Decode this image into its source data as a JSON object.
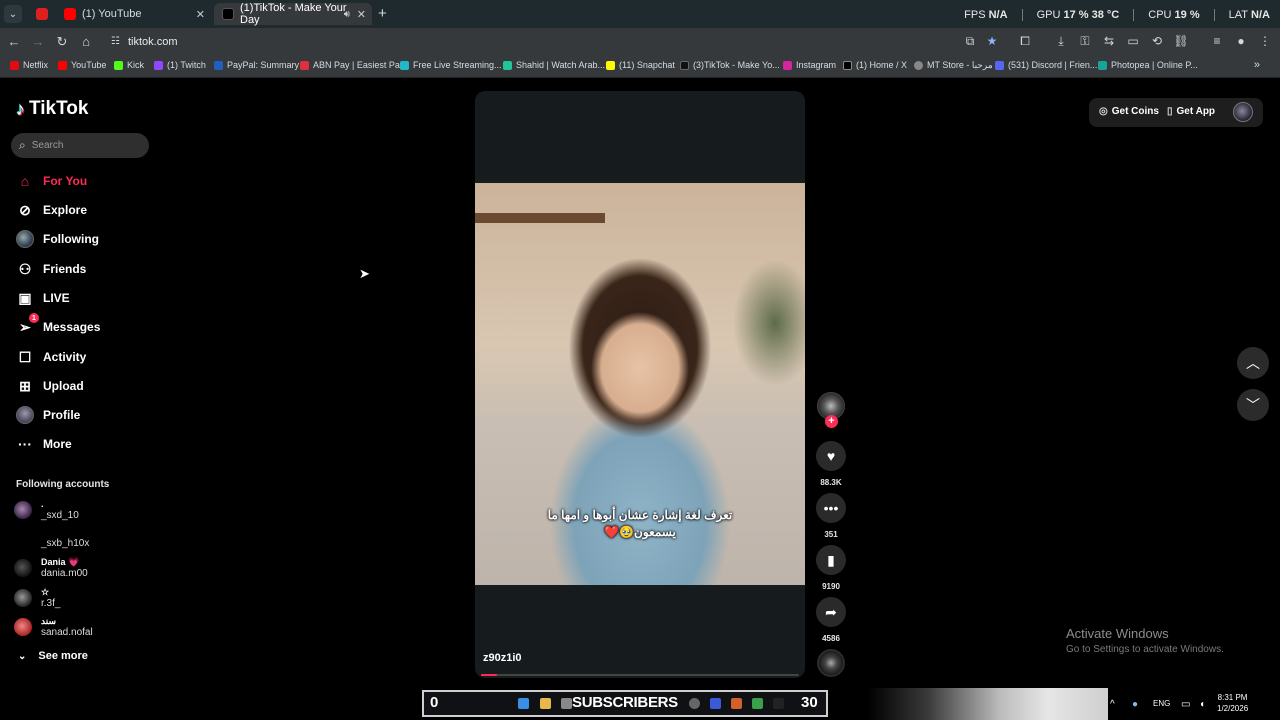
{
  "browser": {
    "tabs": [
      {
        "title": "",
        "favicon_color": "#e02020"
      },
      {
        "title": "(1) YouTube",
        "favicon_color": "#ff0000"
      },
      {
        "title": "(1)TikTok - Make Your Day",
        "favicon_color": "#000000"
      }
    ],
    "perf": {
      "fps_label": "FPS",
      "fps_value": "N/A",
      "gpu_label": "GPU",
      "gpu_value": "17 %",
      "gpu_temp": "38 °C",
      "cpu_label": "CPU",
      "cpu_value": "19 %",
      "lat_label": "LAT",
      "lat_value": "N/A"
    },
    "url": "tiktok.com",
    "bookmarks": [
      {
        "label": "Netflix",
        "color": "#e50914"
      },
      {
        "label": "YouTube",
        "color": "#ff0000"
      },
      {
        "label": "Kick",
        "color": "#53fc18"
      },
      {
        "label": "(1) Twitch",
        "color": "#9146ff"
      },
      {
        "label": "PayPal: Summary",
        "color": "#1f5fbf"
      },
      {
        "label": "ABN Pay | Easiest Pa...",
        "color": "#e03040"
      },
      {
        "label": "Free Live Streaming...",
        "color": "#22b8c8"
      },
      {
        "label": "Shahid | Watch Arab...",
        "color": "#22c49a"
      },
      {
        "label": "(11) Snapchat",
        "color": "#fffc00"
      },
      {
        "label": "(3)TikTok - Make Yo...",
        "color": "#111111"
      },
      {
        "label": "Instagram",
        "color": "#d6249f"
      },
      {
        "label": "(1) Home / X",
        "color": "#000000"
      },
      {
        "label": "MT Store - مرحبا",
        "color": "#888888"
      },
      {
        "label": "(531) Discord | Frien...",
        "color": "#5865f2"
      },
      {
        "label": "Photopea | Online P...",
        "color": "#18a497"
      }
    ]
  },
  "tiktok": {
    "logo_text": "TikTok",
    "search_placeholder": "Search",
    "nav": [
      {
        "label": "For You",
        "icon": "home-icon"
      },
      {
        "label": "Explore",
        "icon": "compass-icon"
      },
      {
        "label": "Following",
        "icon": "avatar-icon"
      },
      {
        "label": "Friends",
        "icon": "friends-icon"
      },
      {
        "label": "LIVE",
        "icon": "live-icon"
      },
      {
        "label": "Messages",
        "icon": "messages-icon",
        "badge": "1"
      },
      {
        "label": "Activity",
        "icon": "activity-icon"
      },
      {
        "label": "Upload",
        "icon": "upload-icon"
      },
      {
        "label": "Profile",
        "icon": "profile-icon"
      },
      {
        "label": "More",
        "icon": "more-icon"
      }
    ],
    "following_title": "Following accounts",
    "accounts": [
      {
        "name": ".",
        "username": "_sxd_10"
      },
      {
        "name": "",
        "username": "_sxb_h10x"
      },
      {
        "name": "Dania 💗",
        "username": "dania.m00"
      },
      {
        "name": "☆",
        "username": "r.3f_"
      },
      {
        "name": "سند",
        "username": "sanad.nofal"
      }
    ],
    "see_more": "See more",
    "video": {
      "caption": "تعرف لغة إشارة عشان أبوها و امها ما يسمعون🥹❤️",
      "author": "z90z1i0",
      "progress": 0.05
    },
    "actions": {
      "likes": "88.3K",
      "comments": "351",
      "saves": "9190",
      "shares": "4586"
    },
    "header": {
      "get_coins": "Get Coins",
      "get_app": "Get App"
    }
  },
  "watermark": {
    "title": "Activate Windows",
    "subtitle": "Go to Settings to activate Windows."
  },
  "taskbar": {
    "sub_left": "0",
    "sub_label": "SUBSCRIBERS",
    "sub_right": "30",
    "language": "ENG",
    "time": "8:31 PM",
    "date": "1/2/2026"
  }
}
